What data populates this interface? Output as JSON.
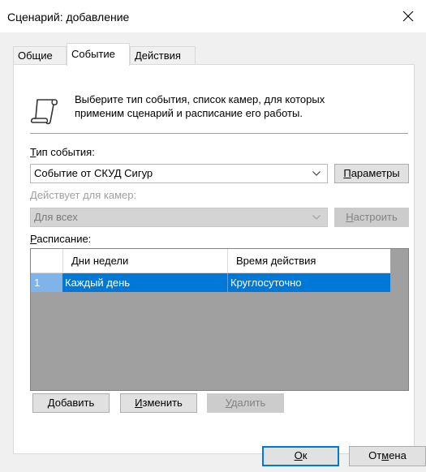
{
  "window": {
    "title": "Сценарий: добавление"
  },
  "tabs": [
    {
      "label": "Общие",
      "active": false
    },
    {
      "label": "Событие",
      "active": true
    },
    {
      "label": "Действия",
      "active": false
    }
  ],
  "icons": {
    "description": "scroll-icon",
    "close": "close-icon",
    "dropdown": "chevron-down-icon"
  },
  "description": {
    "line1": "Выберите тип события, список камер, для которых",
    "line2": "применим сценарий и расписание его работы."
  },
  "event_type": {
    "label_hotkey": "Т",
    "label_rest": "ип события:",
    "value": "Событие от СКУД Сигур",
    "button_hotkey": "П",
    "button_rest": "араметры"
  },
  "cameras": {
    "label_hotkey": "Д",
    "label_rest": "ействует для камер:",
    "value": "Для всех",
    "button_hotkey": "Н",
    "button_rest": "астроить"
  },
  "schedule": {
    "label_hotkey": "Р",
    "label_rest": "асписание:",
    "columns": [
      "Дни недели",
      "Время действия"
    ],
    "rows": [
      {
        "num": "1",
        "days": "Каждый день",
        "time": "Круглосуточно",
        "selected": true
      }
    ]
  },
  "actions": {
    "add_hotkey": "Д",
    "add_rest": "обавить",
    "edit_hotkey": "И",
    "edit_rest": "зменить",
    "delete_hotkey": "У",
    "delete_rest": "далить"
  },
  "footer": {
    "ok_hotkey": "О",
    "ok_rest": "к",
    "cancel_pre": "От",
    "cancel_hotkey": "м",
    "cancel_post": "ена"
  },
  "colors": {
    "selection": "#0078d7",
    "focus_border": "#0078d7",
    "row_header_selected": "#7eb4ea"
  }
}
